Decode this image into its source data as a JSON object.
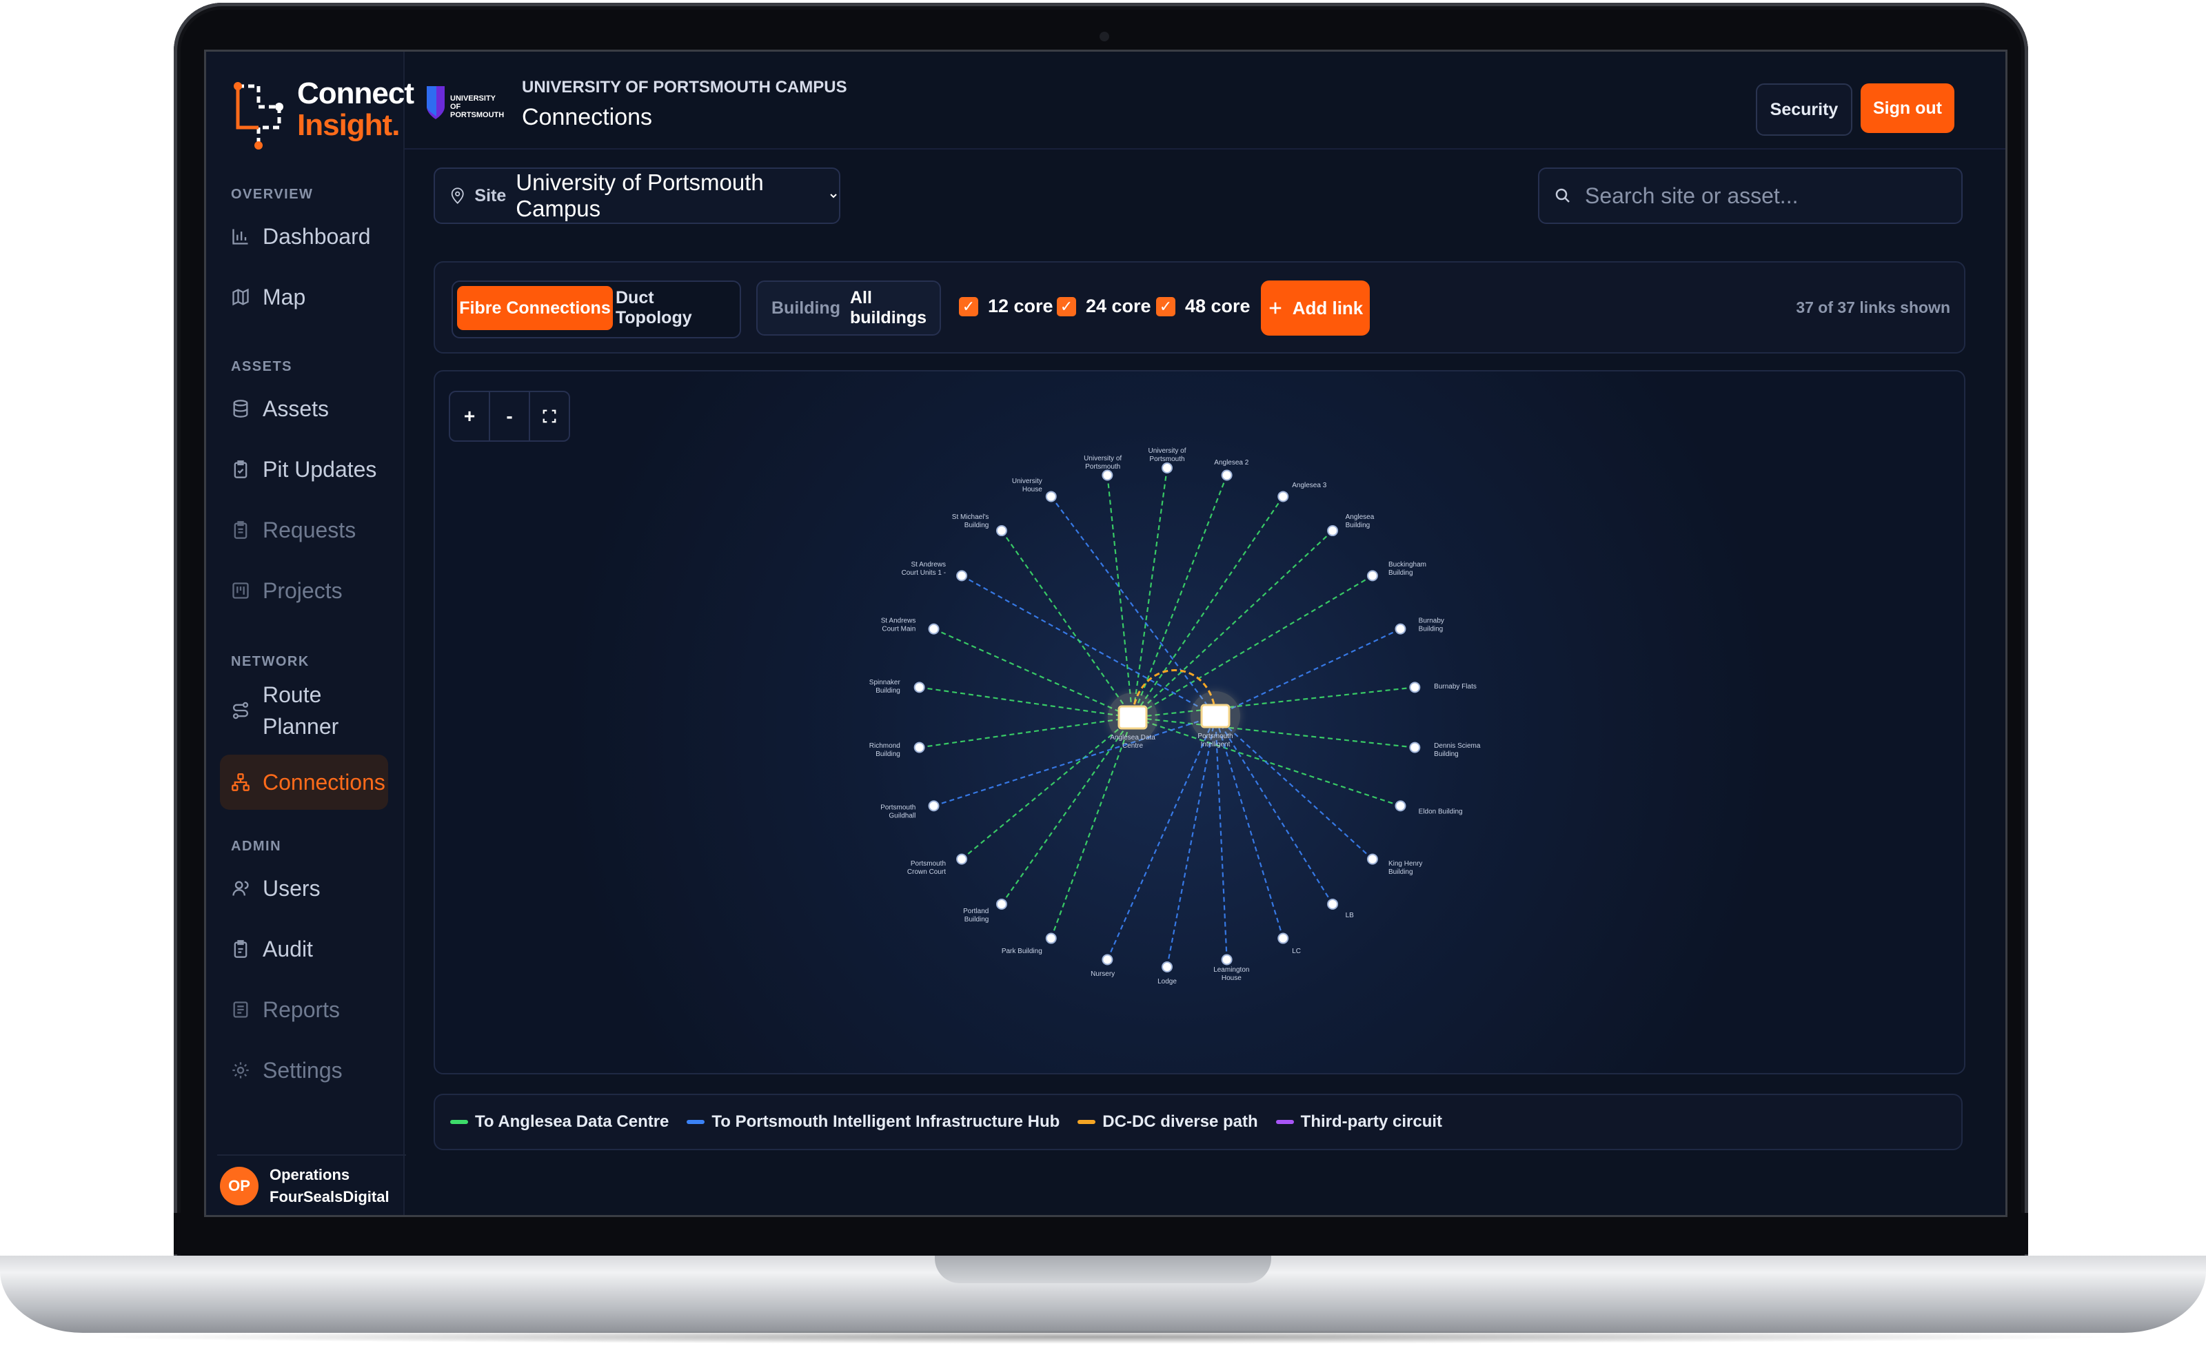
{
  "app": {
    "logo_line1": "Connect",
    "logo_line2": "Insight.",
    "accent": "#ff5a0a"
  },
  "sidebar": {
    "sections": [
      {
        "title": "OVERVIEW",
        "items": [
          {
            "label": "Dashboard",
            "icon": "bar-chart-icon",
            "state": "normal"
          },
          {
            "label": "Map",
            "icon": "map-icon",
            "state": "normal"
          }
        ]
      },
      {
        "title": "ASSETS",
        "items": [
          {
            "label": "Assets",
            "icon": "database-icon",
            "state": "normal"
          },
          {
            "label": "Pit Updates",
            "icon": "clipboard-check-icon",
            "state": "normal"
          },
          {
            "label": "Requests",
            "icon": "clipboard-icon",
            "state": "muted"
          },
          {
            "label": "Projects",
            "icon": "kanban-icon",
            "state": "muted"
          }
        ]
      },
      {
        "title": "NETWORK",
        "items": [
          {
            "label": "Route Planner",
            "icon": "route-icon",
            "state": "normal"
          },
          {
            "label": "Connections",
            "icon": "network-icon",
            "state": "active"
          }
        ]
      },
      {
        "title": "ADMIN",
        "items": [
          {
            "label": "Users",
            "icon": "users-icon",
            "state": "normal"
          },
          {
            "label": "Audit",
            "icon": "audit-icon",
            "state": "normal"
          },
          {
            "label": "Reports",
            "icon": "reports-icon",
            "state": "muted"
          },
          {
            "label": "Settings",
            "icon": "gear-icon",
            "state": "muted"
          }
        ]
      }
    ],
    "user": {
      "initials": "OP",
      "name": "Operations",
      "org": "FourSealsDigital"
    }
  },
  "header": {
    "org_logo_text": "UNIVERSITY OF PORTSMOUTH",
    "subtitle": "UNIVERSITY OF PORTSMOUTH CAMPUS",
    "title": "Connections",
    "security_label": "Security",
    "signout_label": "Sign out"
  },
  "site": {
    "key": "Site",
    "value": "University of Portsmouth Campus"
  },
  "search": {
    "placeholder": "Search site or asset..."
  },
  "toolbar": {
    "tabs": [
      "Fibre Connections",
      "Duct Topology"
    ],
    "active_tab": "Fibre Connections",
    "building_key": "Building",
    "building_value": "All buildings",
    "core_filters": [
      {
        "label": "12 core",
        "checked": true
      },
      {
        "label": "24 core",
        "checked": true
      },
      {
        "label": "48 core",
        "checked": true
      }
    ],
    "add_label": "Add link",
    "links_shown": "37 of 37 links shown"
  },
  "graph": {
    "zoom_in": "+",
    "zoom_out": "-",
    "fit_icon": "fullscreen-icon",
    "hubs": [
      {
        "id": "adc",
        "label_line1": "Anglesea Data",
        "label_line2": "Centre"
      },
      {
        "id": "pih",
        "label_line1": "Portsmouth",
        "label_line2": "Intelligent"
      }
    ],
    "nodes": [
      {
        "label": [
          "University of",
          "Portsmouth"
        ],
        "hub": "adc"
      },
      {
        "label": [
          "Anglesea 2"
        ],
        "hub": "adc"
      },
      {
        "label": [
          "Anglesea 3"
        ],
        "hub": "adc"
      },
      {
        "label": [
          "Anglesea",
          "Building"
        ],
        "hub": "adc"
      },
      {
        "label": [
          "Buckingham",
          "Building"
        ],
        "hub": "adc"
      },
      {
        "label": [
          "Burnaby",
          "Building"
        ],
        "hub": "pih"
      },
      {
        "label": [
          "Burnaby Flats"
        ],
        "hub": "adc"
      },
      {
        "label": [
          "Dennis Sciema",
          "Building"
        ],
        "hub": "adc"
      },
      {
        "label": [
          "Eldon Building"
        ],
        "hub": "adc"
      },
      {
        "label": [
          "King Henry",
          "Building"
        ],
        "hub": "pih"
      },
      {
        "label": [
          "LB"
        ],
        "hub": "pih"
      },
      {
        "label": [
          "LC"
        ],
        "hub": "pih"
      },
      {
        "label": [
          "Leamington",
          "House"
        ],
        "hub": "pih"
      },
      {
        "label": [
          "Lodge"
        ],
        "hub": "pih"
      },
      {
        "label": [
          "Nursery"
        ],
        "hub": "pih"
      },
      {
        "label": [
          "Park Building"
        ],
        "hub": "adc"
      },
      {
        "label": [
          "Portland",
          "Building"
        ],
        "hub": "adc"
      },
      {
        "label": [
          "Portsmouth",
          "Crown Court"
        ],
        "hub": "adc"
      },
      {
        "label": [
          "Portsmouth",
          "Guildhall"
        ],
        "hub": "pih"
      },
      {
        "label": [
          "Richmond",
          "Building"
        ],
        "hub": "adc"
      },
      {
        "label": [
          "Spinnaker",
          "Building"
        ],
        "hub": "adc"
      },
      {
        "label": [
          "St Andrews",
          "Court Main"
        ],
        "hub": "adc"
      },
      {
        "label": [
          "St Andrews",
          "Court Units 1 -"
        ],
        "hub": "pih"
      },
      {
        "label": [
          "St Michael's",
          "Building"
        ],
        "hub": "adc"
      },
      {
        "label": [
          "University",
          "House"
        ],
        "hub": "pih"
      },
      {
        "label": [
          "University of",
          "Portsmouth"
        ],
        "hub": "adc"
      }
    ],
    "colors": {
      "adc": "#3ddc6a",
      "pih": "#3b82f6",
      "dc": "#f5a524",
      "third": "#a855f7",
      "node": "#ffffff"
    }
  },
  "legend": [
    {
      "label": "To Anglesea Data Centre",
      "color": "#3ddc6a"
    },
    {
      "label": "To Portsmouth Intelligent Infrastructure Hub",
      "color": "#3b82f6"
    },
    {
      "label": "DC-DC diverse path",
      "color": "#f5a524"
    },
    {
      "label": "Third-party circuit",
      "color": "#a855f7"
    }
  ]
}
